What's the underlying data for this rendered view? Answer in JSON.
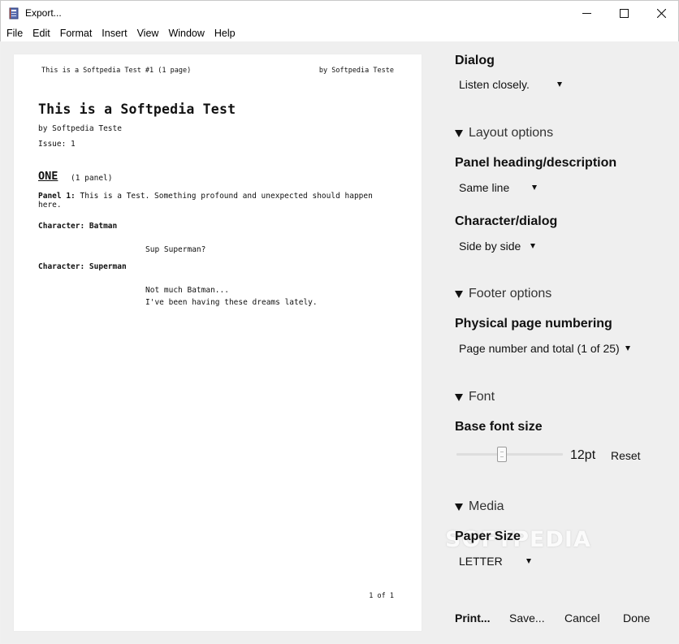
{
  "window": {
    "title": "Export...",
    "icon": "notebook-icon"
  },
  "menu": [
    "File",
    "Edit",
    "Format",
    "Insert",
    "View",
    "Window",
    "Help"
  ],
  "preview": {
    "header_left": "This is a Softpedia Test #1 (1 page)",
    "header_right": "by Softpedia Teste",
    "title": "This is a Softpedia Test",
    "byline": "by Softpedia Teste",
    "issue": "Issue: 1",
    "page_heading": "ONE",
    "page_panel_count": "(1 panel)",
    "panel_label": "Panel 1:",
    "panel_text": "This is a Test. Something profound and unexpected should happen here.",
    "entries": [
      {
        "character": "Character: Batman",
        "lines": [
          "Sup Superman?"
        ]
      },
      {
        "character": "Character: Superman",
        "lines": [
          "Not much Batman...",
          "I've been having these dreams lately."
        ]
      }
    ],
    "footer": "1 of 1"
  },
  "options": {
    "dialog": {
      "label": "Dialog",
      "value": "Listen closely."
    },
    "layout_section": "Layout options",
    "panel_heading": {
      "label": "Panel heading/description",
      "value": "Same line"
    },
    "character_dialog": {
      "label": "Character/dialog",
      "value": "Side by side"
    },
    "footer_section": "Footer options",
    "page_numbering": {
      "label": "Physical page numbering",
      "value": "Page number and total (1 of 25)"
    },
    "font_section": "Font",
    "base_font_size": {
      "label": "Base font size",
      "value": "12pt",
      "slider_fraction": 0.42,
      "reset": "Reset"
    },
    "media_section": "Media",
    "paper_size": {
      "label": "Paper Size",
      "value": "LETTER"
    }
  },
  "watermark": "SOFTPEDIA",
  "buttons": {
    "print": "Print...",
    "save": "Save...",
    "cancel": "Cancel",
    "done": "Done"
  }
}
